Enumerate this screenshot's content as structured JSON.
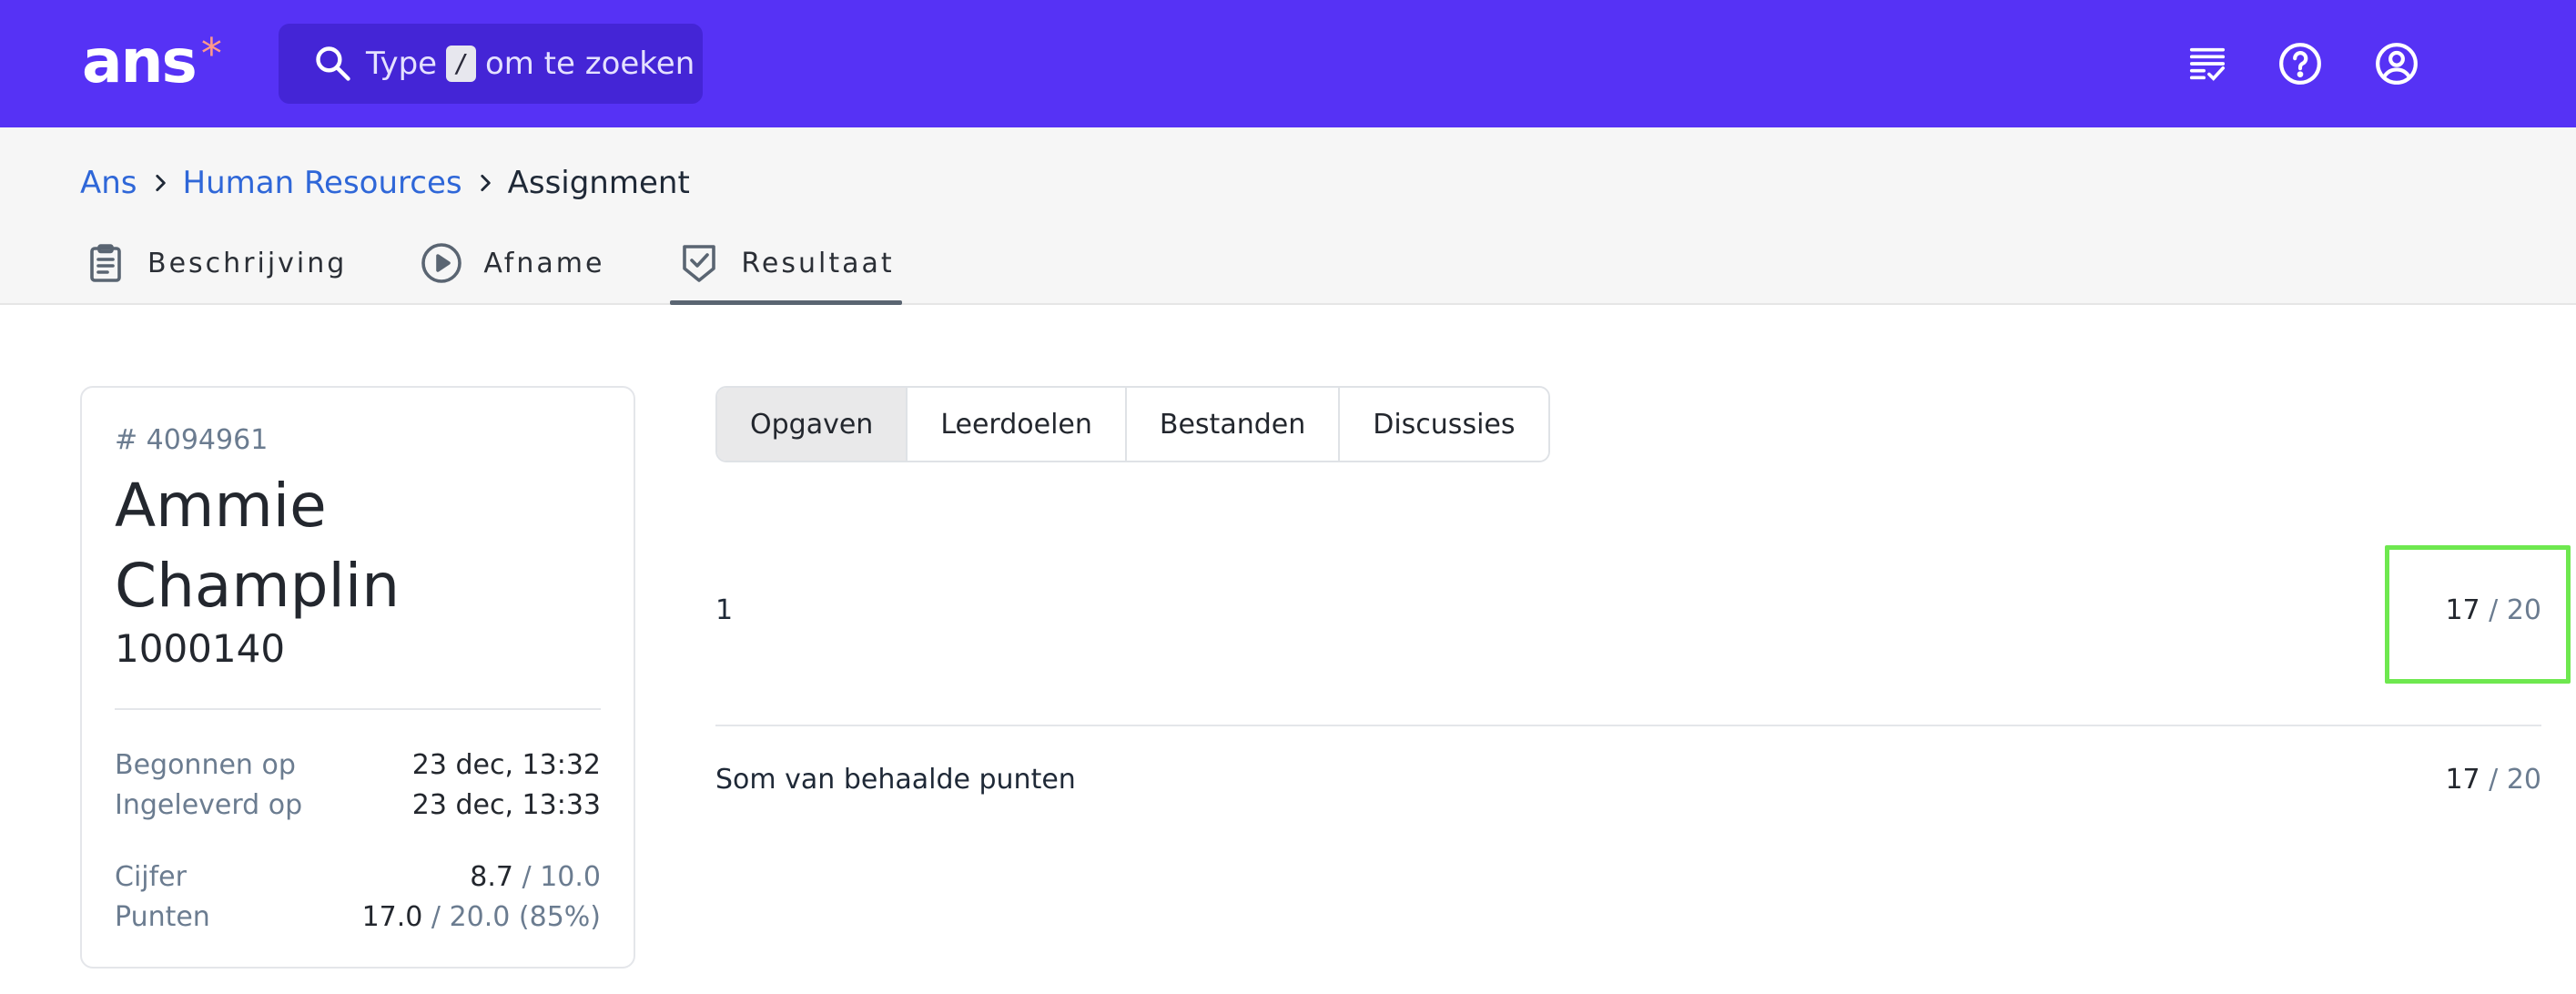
{
  "app": {
    "logo_text": "ans",
    "logo_star": "*",
    "brand_color": "#5632f5"
  },
  "search": {
    "prefix": "Type",
    "key": "/",
    "suffix": "om te zoeken"
  },
  "top_icons": [
    "task-list-icon",
    "help-icon",
    "account-icon"
  ],
  "breadcrumb": {
    "items": [
      {
        "label": "Ans"
      },
      {
        "label": "Human Resources"
      },
      {
        "label": "Assignment"
      }
    ]
  },
  "nav": {
    "tabs": [
      {
        "label": "Beschrijving",
        "icon": "clipboard-icon"
      },
      {
        "label": "Afname",
        "icon": "play-circle-icon"
      },
      {
        "label": "Resultaat",
        "icon": "shield-check-icon",
        "active": true
      }
    ]
  },
  "student": {
    "id": "# 4094961",
    "name": "Ammie Champlin",
    "number": "1000140",
    "started_label": "Begonnen op",
    "started_value": "23 dec, 13:32",
    "submitted_label": "Ingeleverd op",
    "submitted_value": "23 dec, 13:33",
    "grade_label": "Cijfer",
    "grade_value": "8.7",
    "grade_max": "/ 10.0",
    "points_label": "Punten",
    "points_value": "17.0",
    "points_max": "/ 20.0 (85%)"
  },
  "tabs": {
    "items": [
      {
        "label": "Opgaven",
        "active": true
      },
      {
        "label": "Leerdoelen"
      },
      {
        "label": "Bestanden"
      },
      {
        "label": "Discussies"
      }
    ]
  },
  "results": {
    "rows": [
      {
        "label": "1",
        "score": "17",
        "max": "/ 20"
      }
    ],
    "total": {
      "label": "Som van behaalde punten",
      "score": "17",
      "max": "/ 20"
    }
  }
}
